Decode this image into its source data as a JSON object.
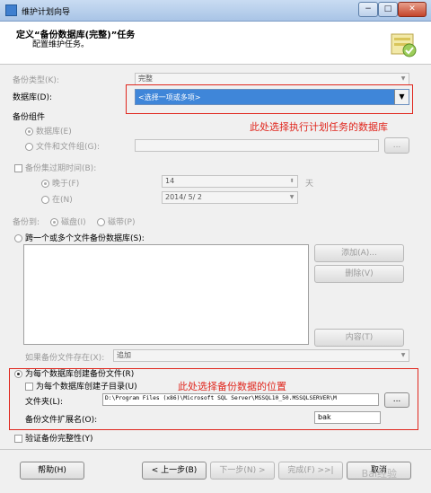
{
  "window": {
    "title": "维护计划向导",
    "minimize": "−",
    "maximize": "□",
    "close": "✕"
  },
  "header": {
    "title": "定义“备份数据库(完整)”任务",
    "subtitle": "配置维护任务。"
  },
  "backup_type": {
    "label": "备份类型(K):",
    "value": "完整"
  },
  "database": {
    "label": "数据库(D):",
    "value": "<选择一项或多项>"
  },
  "backup_component": {
    "label": "备份组件",
    "database_option": "数据库(E)",
    "files_option": "文件和文件组(G):",
    "browse": "..."
  },
  "expire": {
    "label": "备份集过期时间(B):",
    "later_than": "晚于(F)",
    "later_value": "14",
    "unit": "天",
    "on": "在(N)",
    "on_value": "2014/ 5/ 2"
  },
  "backup_to": {
    "label": "备份到:",
    "disk": "磁盘(I)",
    "tape": "磁带(P)"
  },
  "across_files": {
    "label": "跨一个或多个文件备份数据库(S):"
  },
  "file_buttons": {
    "add": "添加(A)...",
    "remove": "删除(V)",
    "contents": "内容(T)"
  },
  "if_exists": {
    "label": "如果备份文件存在(X):",
    "value": "追加"
  },
  "per_database": {
    "create_file": "为每个数据库创建备份文件(R)",
    "create_subdir": "为每个数据库创建子目录(U)",
    "folder_label": "文件夹(L):",
    "folder_value": "D:\\Program Files (x86)\\Microsoft SQL Server\\MSSQL10_50.MSSQLSERVER\\M",
    "folder_browse": "...",
    "ext_label": "备份文件扩展名(O):",
    "ext_value": "bak"
  },
  "verify": {
    "label": "验证备份完整性(Y)"
  },
  "annotations": {
    "database_note": "此处选择执行计划任务的数据库",
    "location_note": "此处选择备份数据的位置"
  },
  "footer": {
    "help": "帮助(H)",
    "back": "< 上一步(B)",
    "next": "下一步(N) >",
    "finish": "完成(F) >>|",
    "cancel": "取消"
  },
  "watermark": "Bai经验"
}
